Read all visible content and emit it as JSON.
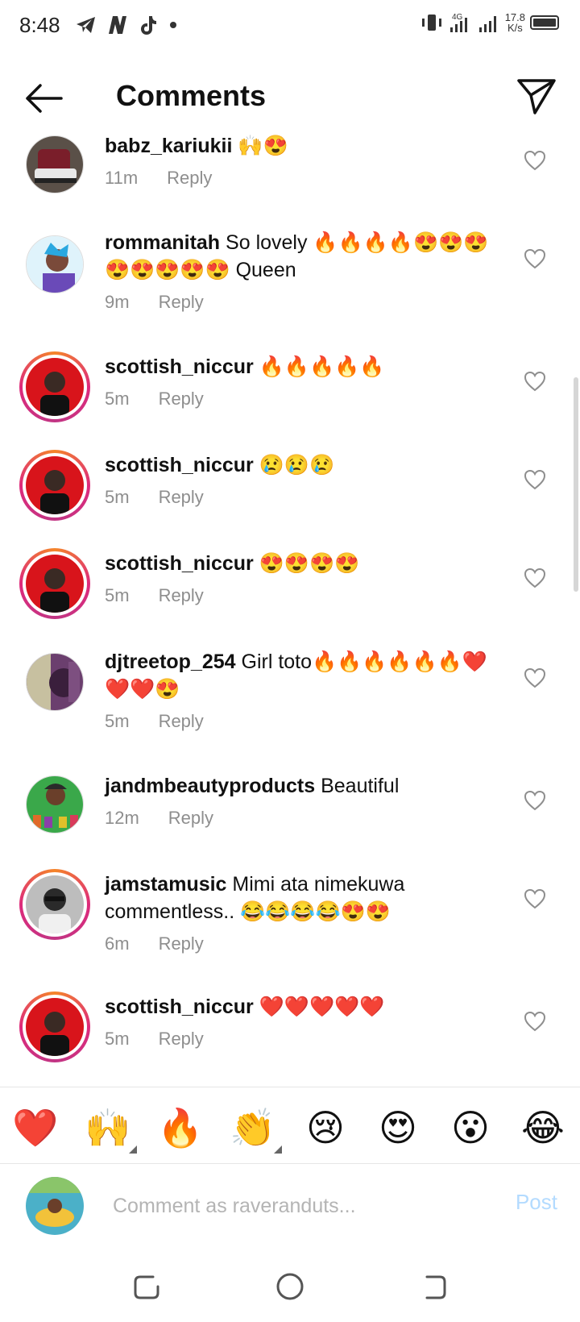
{
  "status_bar": {
    "time": "8:48",
    "network_type": "4G",
    "speed_value": "17.8",
    "speed_unit": "K/s",
    "app_icons": [
      "telegram-icon",
      "netflix-icon",
      "tiktok-icon",
      "dot-icon"
    ]
  },
  "header": {
    "title": "Comments",
    "back_icon": "arrow-left-icon",
    "share_icon": "send-icon"
  },
  "comments": [
    {
      "username": "babz_kariukii",
      "text": " 🙌😍",
      "time": "11m",
      "reply": "Reply",
      "story_ring": false,
      "avatar_color": "#4a3a3a"
    },
    {
      "username": "rommanitah",
      "text": " So lovely 🔥🔥🔥🔥😍😍😍😍😍😍😍😍 Queen",
      "time": "9m",
      "reply": "Reply",
      "story_ring": false,
      "avatar_color": "#9fd8f0"
    },
    {
      "username": "scottish_niccur",
      "text": " 🔥🔥🔥🔥🔥",
      "time": "5m",
      "reply": "Reply",
      "story_ring": true,
      "avatar_color": "#d8141b"
    },
    {
      "username": "scottish_niccur",
      "text": " 😢😢😢",
      "time": "5m",
      "reply": "Reply",
      "story_ring": true,
      "avatar_color": "#d8141b"
    },
    {
      "username": "scottish_niccur",
      "text": " 😍😍😍😍",
      "time": "5m",
      "reply": "Reply",
      "story_ring": true,
      "avatar_color": "#d8141b"
    },
    {
      "username": "djtreetop_254",
      "text": " Girl toto🔥🔥🔥🔥🔥🔥❤️❤️❤️😍",
      "time": "5m",
      "reply": "Reply",
      "story_ring": false,
      "avatar_color": "#6b3f6e"
    },
    {
      "username": "jandmbeautyproducts",
      "text": " Beautiful",
      "time": "12m",
      "reply": "Reply",
      "story_ring": false,
      "avatar_color": "#3aa84a"
    },
    {
      "username": "jamstamusic",
      "text": " Mimi ata nimekuwa commentless.. 😂😂😂😂😍😍",
      "time": "6m",
      "reply": "Reply",
      "story_ring": true,
      "avatar_color": "#555555"
    },
    {
      "username": "scottish_niccur",
      "text": " ❤️❤️❤️❤️❤️",
      "time": "5m",
      "reply": "Reply",
      "story_ring": true,
      "avatar_color": "#d8141b"
    }
  ],
  "emoji_bar": [
    {
      "emoji": "❤️",
      "name": "red-heart-emoji"
    },
    {
      "emoji": "🙌",
      "name": "raising-hands-emoji"
    },
    {
      "emoji": "🔥",
      "name": "fire-emoji"
    },
    {
      "emoji": "👏",
      "name": "clapping-hands-emoji"
    },
    {
      "emoji": "😢",
      "name": "crying-face-emoji"
    },
    {
      "emoji": "😍",
      "name": "heart-eyes-emoji"
    },
    {
      "emoji": "😮",
      "name": "surprised-face-emoji"
    },
    {
      "emoji": "😂",
      "name": "tears-of-joy-emoji"
    }
  ],
  "composer": {
    "placeholder": "Comment as raveranduts...",
    "post_label": "Post"
  },
  "colors": {
    "story_ring_start": "#f58529",
    "story_ring_end": "#dd2a7b",
    "meta_text": "#8e8e8e",
    "post_disabled": "#b3dbff"
  }
}
